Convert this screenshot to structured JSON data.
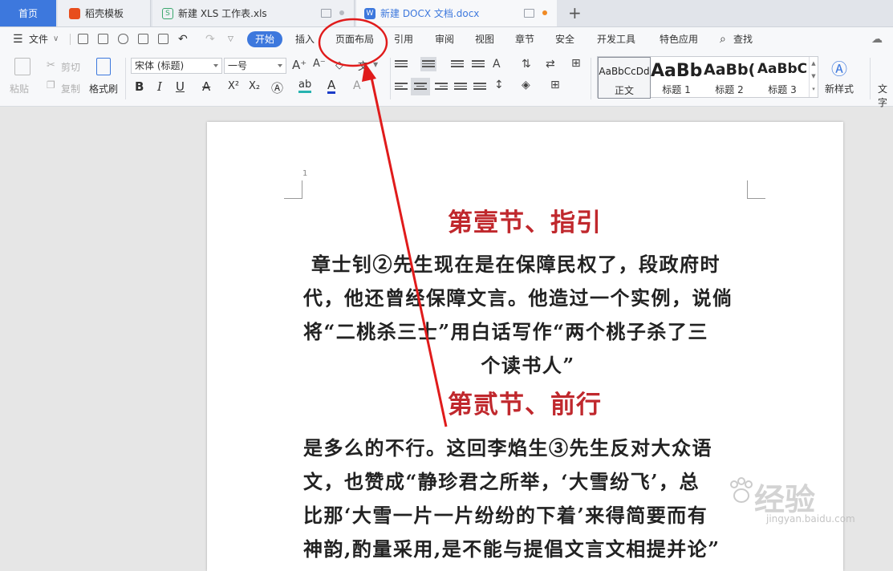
{
  "tabs": {
    "home": "首页",
    "template": "稻壳模板",
    "xls": "新建 XLS 工作表.xls",
    "docx": "新建 DOCX 文档.docx",
    "xls_icon": "S",
    "docx_icon": "W",
    "new_tab": "+"
  },
  "menu": {
    "file": "文件",
    "start": "开始",
    "insert": "插入",
    "page_layout": "页面布局",
    "references": "引用",
    "review": "审阅",
    "view": "视图",
    "chapter": "章节",
    "security": "安全",
    "developer": "开发工具",
    "features": "特色应用",
    "find": "查找"
  },
  "ribbon": {
    "paste": "粘贴",
    "cut": "剪切",
    "copy": "复制",
    "format_painter": "格式刷",
    "font_name": "宋体 (标题)",
    "font_size": "一号",
    "bold": "B",
    "italic": "I",
    "underline": "U",
    "strike": "A",
    "superscript": "X²",
    "subscript": "X₂",
    "font_color": "A",
    "highlight": "ab",
    "grow": "A⁺",
    "shrink": "A⁻",
    "new_style": "新样式",
    "text_tools": "文字"
  },
  "styles": [
    {
      "sample": "AaBbCcDd",
      "name": "正文"
    },
    {
      "sample": "AaBb",
      "name": "标题 1"
    },
    {
      "sample": "AaBb(",
      "name": "标题 2"
    },
    {
      "sample": "AaBbC",
      "name": "标题 3"
    }
  ],
  "document": {
    "line_number": "1",
    "heading1": "第壹节、指引",
    "para1": [
      "章士钊②先生现在是在保障民权了，段政府时",
      "代，他还曾经保障文言。他造过一个实例，说倘",
      "将“二桃杀三士”用白话写作“两个桃子杀了三",
      "个读书人”"
    ],
    "heading2": "第贰节、前行",
    "para2": [
      "是多么的不行。这回李焰生③先生反对大众语",
      "文，也赞成“静珍君之所举，‘大雪纷飞’，总",
      "比那‘大雪一片一片纷纷的下着’来得简要而有",
      "神韵,酌量采用,是不能与提倡文言文相提并论”"
    ]
  },
  "watermark": {
    "text": "经验",
    "url": "jingyan.baidu.com"
  },
  "colors": {
    "accent": "#3d78dd",
    "heading": "#c0282d",
    "annotation": "#e01b1b"
  }
}
